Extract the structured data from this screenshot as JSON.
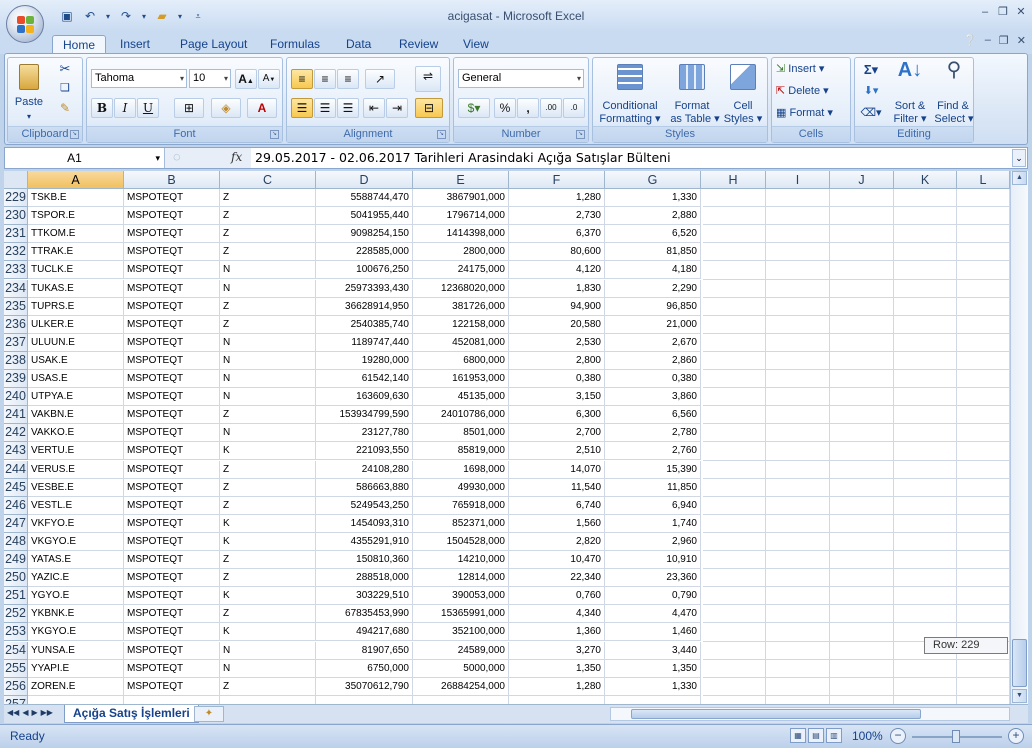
{
  "window": {
    "title": "acigasat - Microsoft Excel"
  },
  "ribbon_tabs": [
    "Home",
    "Insert",
    "Page Layout",
    "Formulas",
    "Data",
    "Review",
    "View"
  ],
  "ribbon": {
    "clipboard": {
      "label": "Clipboard",
      "paste": "Paste"
    },
    "font": {
      "label": "Font",
      "font_name": "Tahoma",
      "font_size": "10"
    },
    "alignment": {
      "label": "Alignment"
    },
    "number": {
      "label": "Number",
      "format": "General",
      "percent": "%",
      "comma": ",",
      "inc_dec": ".00",
      "dec_dec": ".0"
    },
    "styles": {
      "label": "Styles",
      "conditional": "Conditional",
      "conditional2": "Formatting",
      "format_table": "Format",
      "format_table2": "as Table",
      "cell_styles": "Cell",
      "cell_styles2": "Styles"
    },
    "cells": {
      "label": "Cells",
      "insert": "Insert",
      "delete": "Delete",
      "format": "Format"
    },
    "editing": {
      "label": "Editing",
      "sort": "Sort &",
      "sort2": "Filter",
      "find": "Find &",
      "find2": "Select"
    }
  },
  "formula_bar": {
    "name_box": "A1",
    "fx": "fx",
    "content": "29.05.2017 - 02.06.2017 Tarihleri Arasindaki Açığa Satışlar Bülteni"
  },
  "columns": [
    "A",
    "B",
    "C",
    "D",
    "E",
    "F",
    "G",
    "H",
    "I",
    "J",
    "K",
    "L"
  ],
  "rows": [
    {
      "n": "229",
      "a": "TSKB.E",
      "b": "MSPOTEQT",
      "c": "Z",
      "d": "5588744,470",
      "e": "3867901,000",
      "f": "1,280",
      "g": "1,330"
    },
    {
      "n": "230",
      "a": "TSPOR.E",
      "b": "MSPOTEQT",
      "c": "Z",
      "d": "5041955,440",
      "e": "1796714,000",
      "f": "2,730",
      "g": "2,880"
    },
    {
      "n": "231",
      "a": "TTKOM.E",
      "b": "MSPOTEQT",
      "c": "Z",
      "d": "9098254,150",
      "e": "1414398,000",
      "f": "6,370",
      "g": "6,520"
    },
    {
      "n": "232",
      "a": "TTRAK.E",
      "b": "MSPOTEQT",
      "c": "Z",
      "d": "228585,000",
      "e": "2800,000",
      "f": "80,600",
      "g": "81,850"
    },
    {
      "n": "233",
      "a": "TUCLK.E",
      "b": "MSPOTEQT",
      "c": "N",
      "d": "100676,250",
      "e": "24175,000",
      "f": "4,120",
      "g": "4,180"
    },
    {
      "n": "234",
      "a": "TUKAS.E",
      "b": "MSPOTEQT",
      "c": "N",
      "d": "25973393,430",
      "e": "12368020,000",
      "f": "1,830",
      "g": "2,290"
    },
    {
      "n": "235",
      "a": "TUPRS.E",
      "b": "MSPOTEQT",
      "c": "Z",
      "d": "36628914,950",
      "e": "381726,000",
      "f": "94,900",
      "g": "96,850"
    },
    {
      "n": "236",
      "a": "ULKER.E",
      "b": "MSPOTEQT",
      "c": "Z",
      "d": "2540385,740",
      "e": "122158,000",
      "f": "20,580",
      "g": "21,000"
    },
    {
      "n": "237",
      "a": "ULUUN.E",
      "b": "MSPOTEQT",
      "c": "N",
      "d": "1189747,440",
      "e": "452081,000",
      "f": "2,530",
      "g": "2,670"
    },
    {
      "n": "238",
      "a": "USAK.E",
      "b": "MSPOTEQT",
      "c": "N",
      "d": "19280,000",
      "e": "6800,000",
      "f": "2,800",
      "g": "2,860"
    },
    {
      "n": "239",
      "a": "USAS.E",
      "b": "MSPOTEQT",
      "c": "N",
      "d": "61542,140",
      "e": "161953,000",
      "f": "0,380",
      "g": "0,380"
    },
    {
      "n": "240",
      "a": "UTPYA.E",
      "b": "MSPOTEQT",
      "c": "N",
      "d": "163609,630",
      "e": "45135,000",
      "f": "3,150",
      "g": "3,860"
    },
    {
      "n": "241",
      "a": "VAKBN.E",
      "b": "MSPOTEQT",
      "c": "Z",
      "d": "153934799,590",
      "e": "24010786,000",
      "f": "6,300",
      "g": "6,560"
    },
    {
      "n": "242",
      "a": "VAKKO.E",
      "b": "MSPOTEQT",
      "c": "N",
      "d": "23127,780",
      "e": "8501,000",
      "f": "2,700",
      "g": "2,780"
    },
    {
      "n": "243",
      "a": "VERTU.E",
      "b": "MSPOTEQT",
      "c": "K",
      "d": "221093,550",
      "e": "85819,000",
      "f": "2,510",
      "g": "2,760"
    },
    {
      "n": "244",
      "a": "VERUS.E",
      "b": "MSPOTEQT",
      "c": "Z",
      "d": "24108,280",
      "e": "1698,000",
      "f": "14,070",
      "g": "15,390"
    },
    {
      "n": "245",
      "a": "VESBE.E",
      "b": "MSPOTEQT",
      "c": "Z",
      "d": "586663,880",
      "e": "49930,000",
      "f": "11,540",
      "g": "11,850"
    },
    {
      "n": "246",
      "a": "VESTL.E",
      "b": "MSPOTEQT",
      "c": "Z",
      "d": "5249543,250",
      "e": "765918,000",
      "f": "6,740",
      "g": "6,940"
    },
    {
      "n": "247",
      "a": "VKFYO.E",
      "b": "MSPOTEQT",
      "c": "K",
      "d": "1454093,310",
      "e": "852371,000",
      "f": "1,560",
      "g": "1,740"
    },
    {
      "n": "248",
      "a": "VKGYO.E",
      "b": "MSPOTEQT",
      "c": "K",
      "d": "4355291,910",
      "e": "1504528,000",
      "f": "2,820",
      "g": "2,960"
    },
    {
      "n": "249",
      "a": "YATAS.E",
      "b": "MSPOTEQT",
      "c": "Z",
      "d": "150810,360",
      "e": "14210,000",
      "f": "10,470",
      "g": "10,910"
    },
    {
      "n": "250",
      "a": "YAZIC.E",
      "b": "MSPOTEQT",
      "c": "Z",
      "d": "288518,000",
      "e": "12814,000",
      "f": "22,340",
      "g": "23,360"
    },
    {
      "n": "251",
      "a": "YGYO.E",
      "b": "MSPOTEQT",
      "c": "K",
      "d": "303229,510",
      "e": "390053,000",
      "f": "0,760",
      "g": "0,790"
    },
    {
      "n": "252",
      "a": "YKBNK.E",
      "b": "MSPOTEQT",
      "c": "Z",
      "d": "67835453,990",
      "e": "15365991,000",
      "f": "4,340",
      "g": "4,470"
    },
    {
      "n": "253",
      "a": "YKGYO.E",
      "b": "MSPOTEQT",
      "c": "K",
      "d": "494217,680",
      "e": "352100,000",
      "f": "1,360",
      "g": "1,460"
    },
    {
      "n": "254",
      "a": "YUNSA.E",
      "b": "MSPOTEQT",
      "c": "N",
      "d": "81907,650",
      "e": "24589,000",
      "f": "3,270",
      "g": "3,440"
    },
    {
      "n": "255",
      "a": "YYAPI.E",
      "b": "MSPOTEQT",
      "c": "N",
      "d": "6750,000",
      "e": "5000,000",
      "f": "1,350",
      "g": "1,350"
    },
    {
      "n": "256",
      "a": "ZOREN.E",
      "b": "MSPOTEQT",
      "c": "Z",
      "d": "35070612,790",
      "e": "26884254,000",
      "f": "1,280",
      "g": "1,330"
    },
    {
      "n": "257",
      "a": "",
      "b": "",
      "c": "",
      "d": "",
      "e": "",
      "f": "",
      "g": ""
    }
  ],
  "scroll_tip": "Row: 229",
  "sheet_tab": "Açığa Satış İşlemleri",
  "status": {
    "ready": "Ready",
    "zoom": "100%"
  },
  "colors": {
    "accent": "#15428b",
    "selected_header": "#f1c15f",
    "ribbon_bg": "#dde8f6"
  }
}
